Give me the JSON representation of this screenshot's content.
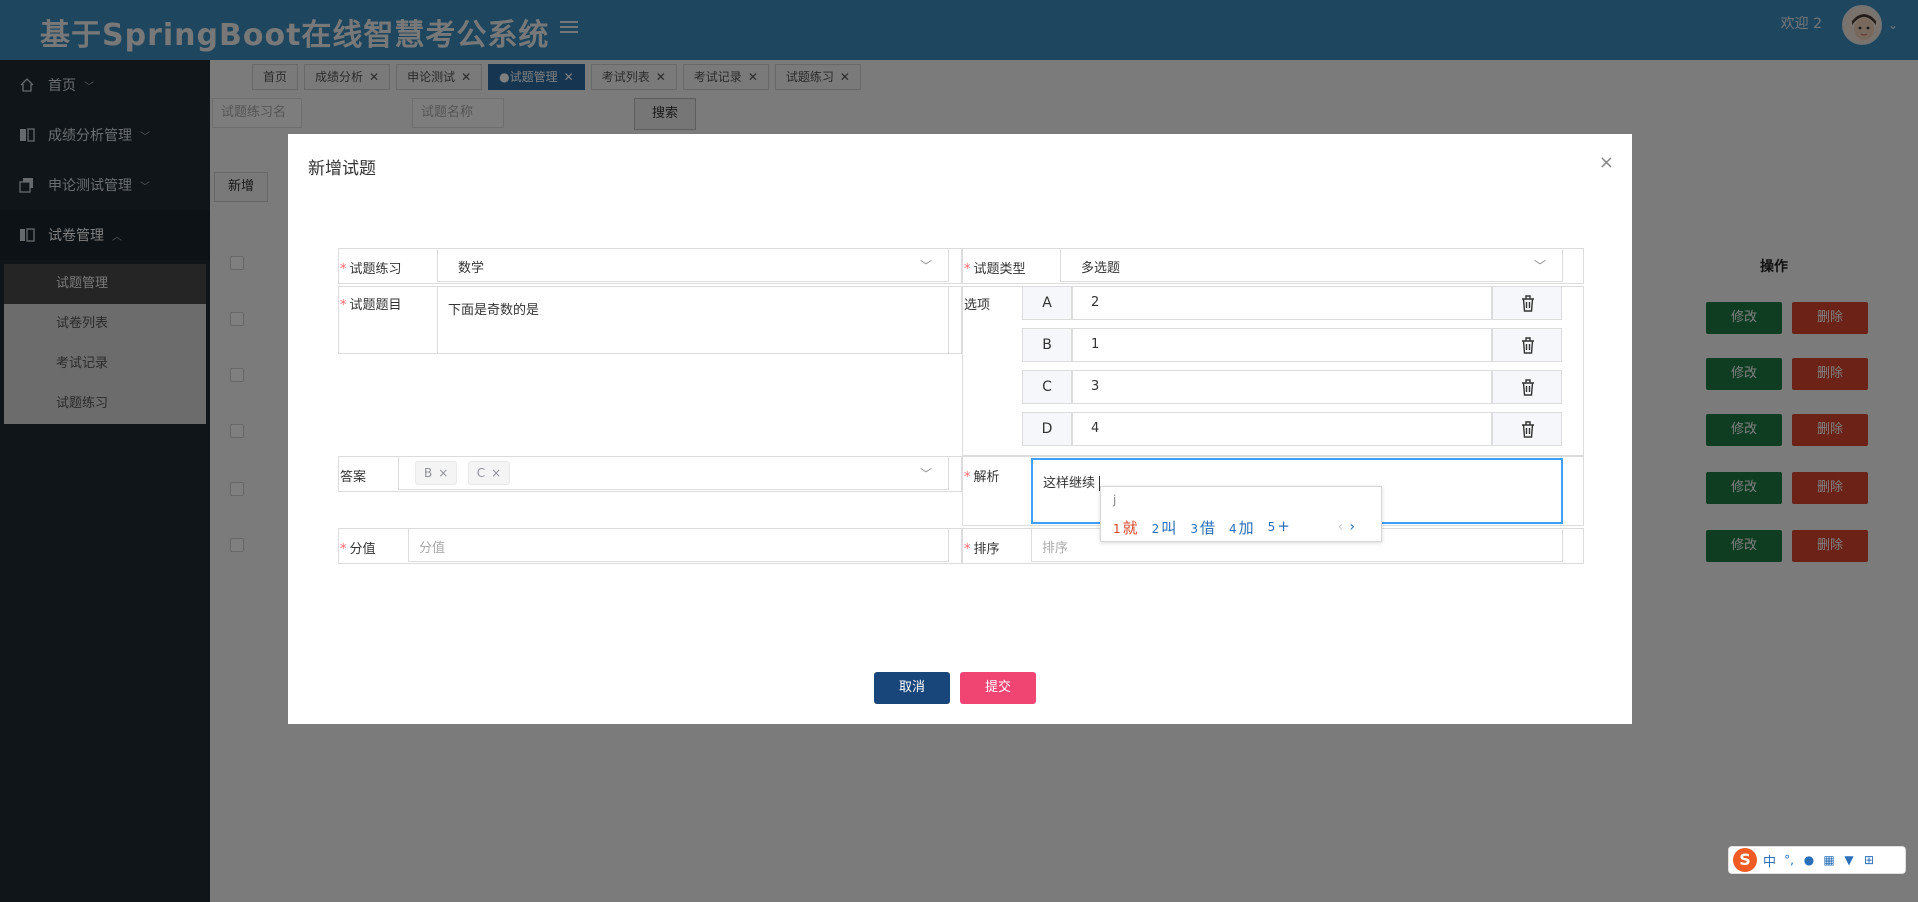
{
  "header": {
    "app_title": "基于SpringBoot在线智慧考公系统",
    "welcome": "欢迎 2"
  },
  "sidebar": {
    "items": [
      {
        "label": "首页",
        "icon": "home-icon"
      },
      {
        "label": "成绩分析管理",
        "icon": "columns-icon"
      },
      {
        "label": "申论测试管理",
        "icon": "copy-icon"
      },
      {
        "label": "试卷管理",
        "icon": "columns-icon"
      }
    ],
    "submenu": [
      {
        "label": "试题管理"
      },
      {
        "label": "试卷列表"
      },
      {
        "label": "考试记录"
      },
      {
        "label": "试题练习"
      }
    ]
  },
  "tabs": [
    {
      "label": "首页",
      "closable": false
    },
    {
      "label": "成绩分析",
      "closable": true
    },
    {
      "label": "申论测试",
      "closable": true
    },
    {
      "label": "●试题管理",
      "closable": true,
      "active": true
    },
    {
      "label": "考试列表",
      "closable": true
    },
    {
      "label": "考试记录",
      "closable": true
    },
    {
      "label": "试题练习",
      "closable": true
    }
  ],
  "search": {
    "field1_placeholder": "试题练习名",
    "field2_placeholder": "试题名称",
    "button": "搜索",
    "add_button": "新增"
  },
  "table": {
    "ops_header": "操作",
    "edit_label": "修改",
    "delete_label": "删除"
  },
  "modal": {
    "title": "新增试题",
    "close": "×",
    "fields": {
      "practice_label": "试题练习",
      "practice_value": "数学",
      "type_label": "试题类型",
      "type_value": "多选题",
      "question_label": "试题题目",
      "question_value": "下面是奇数的是",
      "options_label": "选项",
      "answer_label": "答案",
      "analysis_label": "解析",
      "analysis_value": "这样继续",
      "score_label": "分值",
      "score_placeholder": "分值",
      "sort_label": "排序",
      "sort_placeholder": "排序"
    },
    "options": [
      {
        "letter": "A",
        "value": "2"
      },
      {
        "letter": "B",
        "value": "1"
      },
      {
        "letter": "C",
        "value": "3"
      },
      {
        "letter": "D",
        "value": "4"
      }
    ],
    "answer_tags": [
      "B",
      "C"
    ],
    "cancel": "取消",
    "submit": "提交"
  },
  "ime_popup": {
    "composition": "j",
    "candidates": [
      {
        "n": "1",
        "text": "就"
      },
      {
        "n": "2",
        "text": "叫"
      },
      {
        "n": "3",
        "text": "借"
      },
      {
        "n": "4",
        "text": "加"
      },
      {
        "n": "5",
        "text": "+"
      }
    ]
  },
  "ime_bar": {
    "logo": "S",
    "mode": "中"
  },
  "colors": {
    "header": "#3c8dbc",
    "sidebar": "#1f2a33",
    "edit": "#1c7a45",
    "delete": "#d9442c",
    "cancel": "#18457a",
    "submit": "#f04472"
  }
}
